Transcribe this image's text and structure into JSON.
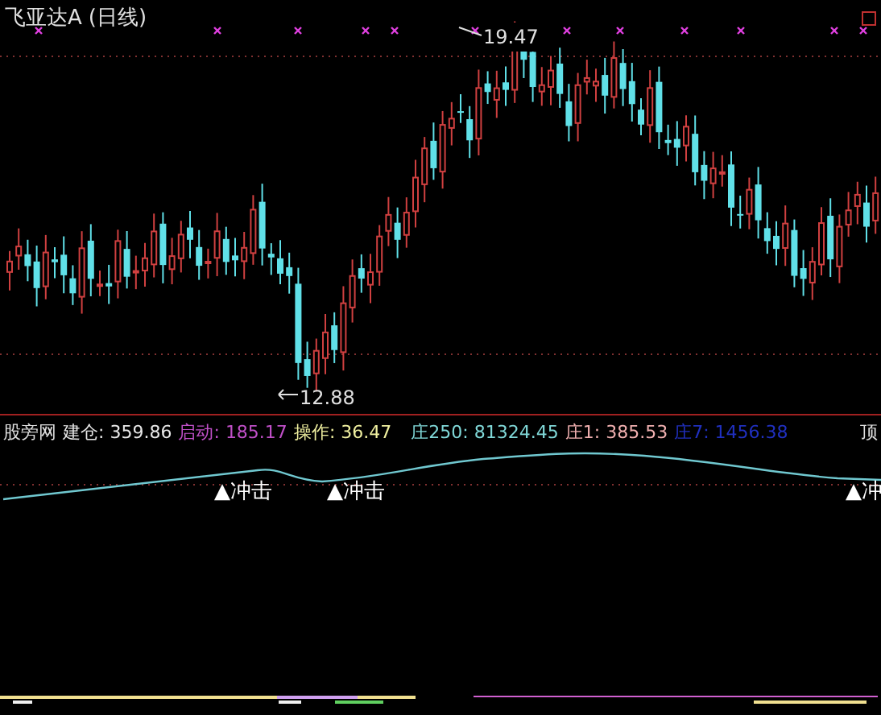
{
  "title": "飞亚达A",
  "period": "(日线)",
  "price_chart": {
    "high_label": "19.47",
    "low_label": "12.88"
  },
  "indicator": {
    "name": "股旁网",
    "values": [
      {
        "label": "建仓:",
        "value": "359.86",
        "color": "#e8e8e8"
      },
      {
        "label": "启动:",
        "value": "185.17",
        "color": "#c050c8"
      },
      {
        "label": "操作:",
        "value": "36.47",
        "color": "#f0f0a0"
      },
      {
        "label": "庄250:",
        "value": "81324.45",
        "color": "#80d8d8"
      },
      {
        "label": "庄1:",
        "value": "385.53",
        "color": "#f0b0b0"
      },
      {
        "label": "庄7:",
        "value": "1456.38",
        "color": "#2030c0"
      }
    ],
    "trailing_label": "顶",
    "signals": [
      {
        "text": "▲冲击"
      },
      {
        "text": "▲冲击"
      },
      {
        "text": "▲冲"
      }
    ]
  }
}
